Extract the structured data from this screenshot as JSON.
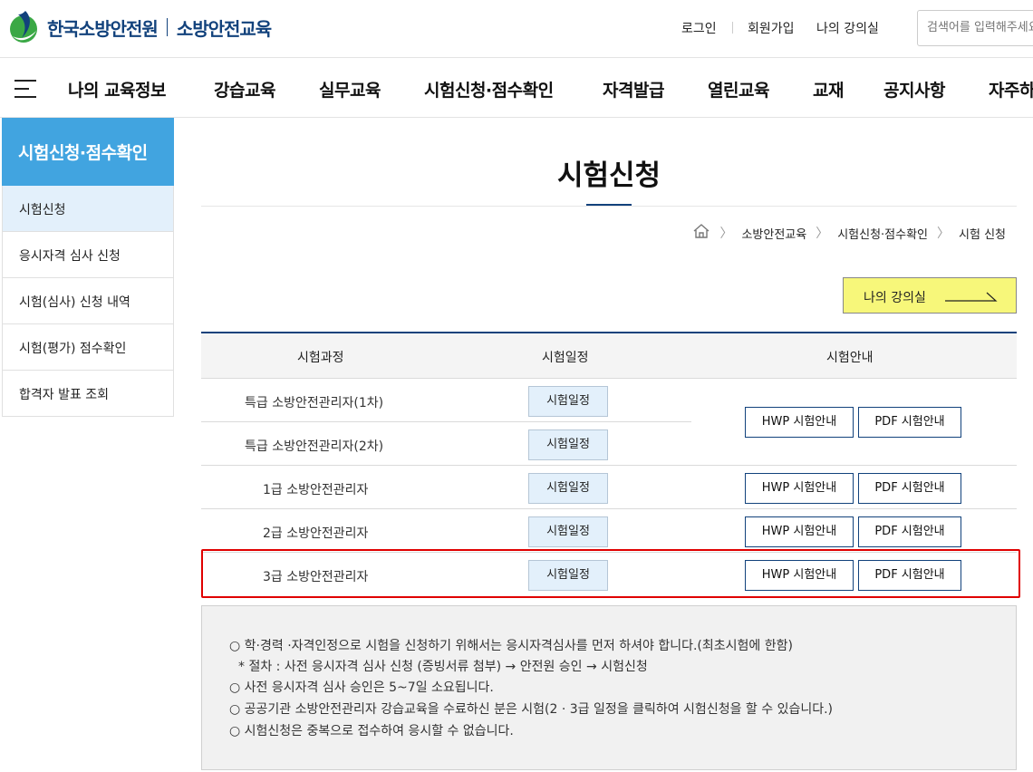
{
  "header": {
    "logo_name": "한국소방안전원",
    "logo_sub": "소방안전교육",
    "util_links": [
      "로그인",
      "회원가입",
      "나의 강의실"
    ],
    "search_placeholder": "검색어를 입력해주세요"
  },
  "gnb": {
    "menu_icon": "hamburger-icon",
    "items": [
      "나의 교육정보",
      "강습교육",
      "실무교육",
      "시험신청·점수확인",
      "자격발급",
      "열린교육",
      "교재",
      "공지사항",
      "자주하"
    ]
  },
  "sidebar": {
    "title": "시험신청·점수확인",
    "items": [
      "시험신청",
      "응시자격 심사 신청",
      "시험(심사) 신청 내역",
      "시험(평가) 점수확인",
      "합격자 발표 조회"
    ],
    "active_index": 0
  },
  "page": {
    "title": "시험신청",
    "breadcrumb": [
      "소방안전교육",
      "시험신청·점수확인",
      "시험 신청"
    ],
    "my_lecture_button": "나의 강의실"
  },
  "table": {
    "headers": [
      "시험과정",
      "시험일정",
      "시험안내"
    ],
    "rows": [
      {
        "course": "특급 소방안전관리자(1차)",
        "schedule": "시험일정"
      },
      {
        "course": "특급 소방안전관리자(2차)",
        "schedule": "시험일정"
      },
      {
        "course": "1급 소방안전관리자",
        "schedule": "시험일정"
      },
      {
        "course": "2급 소방안전관리자",
        "schedule": "시험일정"
      },
      {
        "course": "3급 소방안전관리자",
        "schedule": "시험일정"
      }
    ],
    "guides": [
      {
        "hwp": "HWP 시험안내",
        "pdf": "PDF 시험안내"
      },
      {
        "hwp": "HWP 시험안내",
        "pdf": "PDF 시험안내"
      },
      {
        "hwp": "HWP 시험안내",
        "pdf": "PDF 시험안내"
      },
      {
        "hwp": "HWP 시험안내",
        "pdf": "PDF 시험안내"
      }
    ],
    "highlight_color": "#e00000"
  },
  "notes": [
    "○ 학·경력 ·자격인정으로 시험을 신청하기 위해서는 응시자격심사를 먼저 하셔야 합니다.(최초시험에 한함)",
    "* 절차 : 사전 응시자격 심사 신청 (증빙서류 첨부) → 안전원 승인 → 시험신청",
    "○ 사전 응시자격 심사 승인은 5~7일 소요됩니다.",
    "○ 공공기관 소방안전관리자 강습교육을 수료하신 분은 시험(2 · 3급 일정을 클릭하여 시험신청을 할 수 있습니다.)",
    "○ 시험신청은 중복으로 접수하여 응시할 수 없습니다."
  ],
  "colors": {
    "brand": "#12427c",
    "sidebar_title_bg": "#41a4e0",
    "active_bg": "#e3f0fb",
    "my_lecture_bg": "#f7f77a"
  }
}
